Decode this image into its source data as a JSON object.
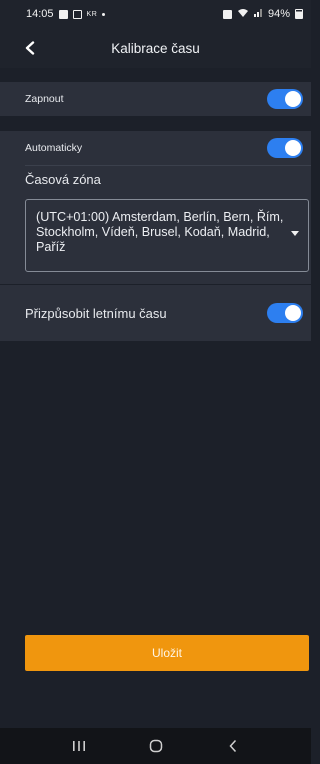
{
  "status_bar": {
    "time": "14:05",
    "small_text": "KR",
    "battery": "94%",
    "icons": [
      "gallery-icon",
      "calendar-icon",
      "dot-icon",
      "alarm-icon",
      "wifi-icon",
      "signal-icon",
      "battery-icon"
    ]
  },
  "header": {
    "title": "Kalibrace času",
    "back_icon": "chevron-left-icon"
  },
  "settings": {
    "enable": {
      "label": "Zapnout",
      "on": true
    },
    "automatic": {
      "label": "Automaticky",
      "on": true
    },
    "timezone": {
      "label": "Časová zóna",
      "value": "(UTC+01:00) Amsterdam, Berlín, Bern, Řím, Stockholm, Vídeň, Brusel, Kodaň, Madrid, Paříž"
    },
    "dst": {
      "label": "Přizpůsobit letnímu času",
      "on": true
    }
  },
  "save_button": {
    "label": "Uložit"
  },
  "nav_bar": {
    "items": [
      "recents-icon",
      "home-icon",
      "back-icon"
    ]
  },
  "colors": {
    "background": "#1c2029",
    "section": "#2c303b",
    "toggle_on": "#2d7ff0",
    "save": "#f0960e"
  }
}
